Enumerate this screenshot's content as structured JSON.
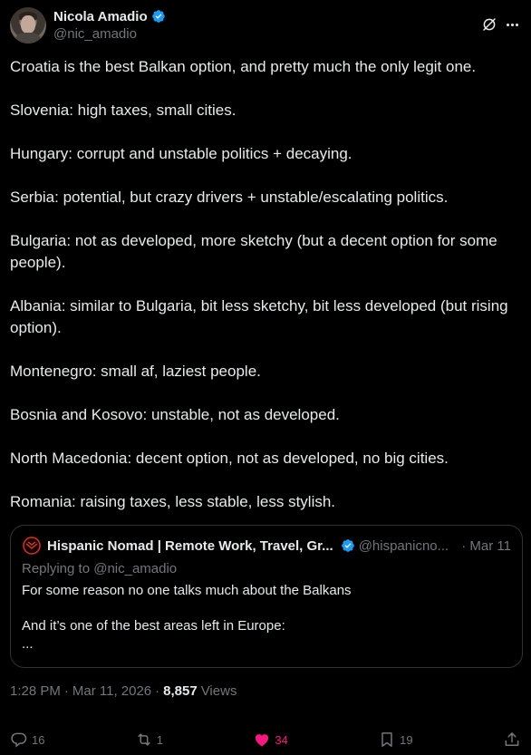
{
  "author": {
    "name": "Nicola Amadio",
    "handle": "@nic_amadio"
  },
  "tweet": {
    "paragraphs": [
      "Croatia is the best Balkan option, and pretty much the only legit one.",
      "Slovenia: high taxes, small cities.",
      "Hungary: corrupt and unstable politics + decaying.",
      "Serbia: potential, but crazy drivers + unstable/escalating politics.",
      "Bulgaria: not as developed, more sketchy (but a decent option for some people).",
      "Albania: similar to Bulgaria, bit less sketchy, bit less developed (but rising option).",
      "Montenegro: small af, laziest people.",
      "Bosnia and Kosovo: unstable, not as developed.",
      "North Macedonia: decent option, not as developed, no big cities.",
      "Romania: raising taxes, less stable, less stylish."
    ]
  },
  "quote": {
    "name": "Hispanic Nomad | Remote Work, Travel, Gr...",
    "handle": "@hispanicno...",
    "date": "· Mar 11",
    "replying_to": "Replying to @nic_amadio",
    "body": [
      "For some reason no one talks much about the Balkans",
      "And it’s one of the best areas left in Europe:\n..."
    ]
  },
  "meta": {
    "time": "1:28 PM",
    "date": "Mar 11, 2026",
    "views_count": "8,857",
    "views_label": "Views",
    "dot": "·"
  },
  "actions": {
    "replies": "16",
    "reposts": "1",
    "likes": "34",
    "bookmarks": "19"
  },
  "colors": {
    "background": "#000000",
    "text": "#e7e9ea",
    "muted": "#71767b",
    "verified": "#1d9bf0",
    "like": "#f91880",
    "border": "#2f3336"
  },
  "icons": [
    "verified-badge-icon",
    "grok-icon",
    "more-icon",
    "reply-icon",
    "repost-icon",
    "heart-icon",
    "bookmark-icon",
    "share-icon"
  ]
}
